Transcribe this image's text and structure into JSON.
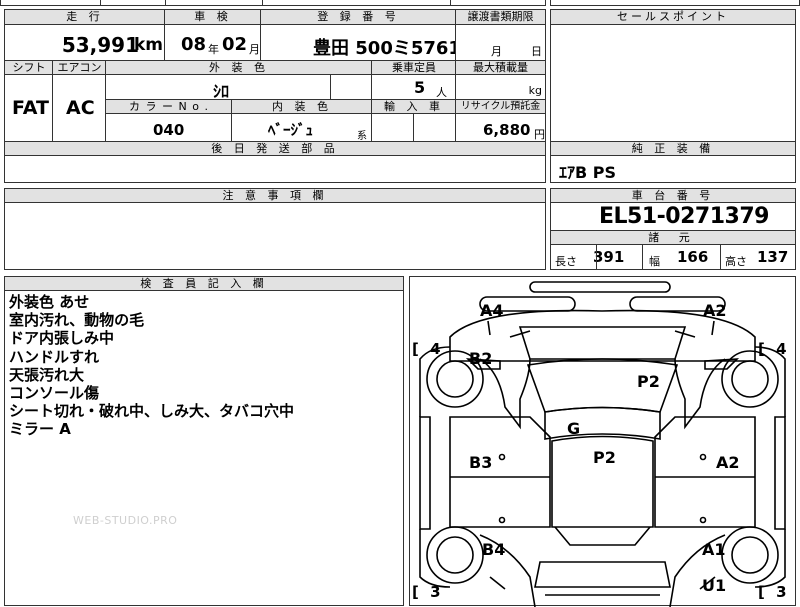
{
  "header_row": {
    "mileage_label": "走 行",
    "inspection_label": "車 検",
    "registration_label": "登 録 番 号",
    "transfer_label": "譲渡書類期限",
    "sales_point_label": "セールスポイント"
  },
  "values_row": {
    "mileage": "53,991",
    "mileage_unit": "km",
    "insp_year": "08",
    "insp_year_unit": "年",
    "insp_month": "02",
    "insp_month_unit": "月",
    "registration": "豊田 500ミ5761",
    "transfer_month": "月",
    "transfer_day": "日"
  },
  "spec": {
    "shift_label": "シフト",
    "aircon_label": "エアコン",
    "exterior_color_label": "外 装 色",
    "capacity_label": "乗車定員",
    "max_load_label": "最大積載量",
    "shift": "FAT",
    "aircon": "AC",
    "exterior_color": "ｼﾛ",
    "capacity": "5",
    "capacity_unit": "人",
    "max_load_unit": "kg",
    "color_no_label": "カ ラ ー N o .",
    "interior_color_label": "内 装 色",
    "import_label": "輸 入 車",
    "recycle_label": "リサイクル預託金",
    "color_no": "040",
    "interior_color": "ﾍﾞｰｼﾞｭ",
    "interior_suffix": "系",
    "recycle_fee": "6,880",
    "recycle_unit": "円",
    "later_parts_label": "後 日 発 送 部 品"
  },
  "oem_equipment": {
    "label": "純 正 装 備",
    "value": "ｴｱB PS"
  },
  "caution": {
    "label": "注 意 事 項 欄"
  },
  "chassis": {
    "label": "車 台 番 号",
    "number": "EL51-0271379",
    "specs_label": "諸 元",
    "length_label": "長さ",
    "length": "391",
    "width_label": "幅",
    "width": "166",
    "height_label": "高さ",
    "height": "137"
  },
  "inspector": {
    "label": "検 査 員 記 入 欄",
    "notes": [
      "外装色 あせ",
      "室内汚れ、動物の毛",
      "ドア内張しみ中",
      "ハンドルすれ",
      "天張汚れ大",
      "コンソール傷",
      "シート切れ・破れ中、しみ大、タバコ穴中",
      "ミラー A"
    ],
    "watermark": "WEB-STUDIO.PRO"
  },
  "diagram": {
    "tire_front_left": "4",
    "tire_front_right": "4",
    "tire_rear_left": "3",
    "tire_rear_right": "3",
    "bracket_open": "[",
    "bracket_close": "]",
    "marks": {
      "a4": "A4",
      "a2_top": "A2",
      "b2": "B2",
      "p2_windshield": "P2",
      "g": "G",
      "b3": "B3",
      "p2_roof": "P2",
      "a2_right": "A2",
      "b4": "B4",
      "a1": "A1",
      "u1": "U1"
    }
  }
}
